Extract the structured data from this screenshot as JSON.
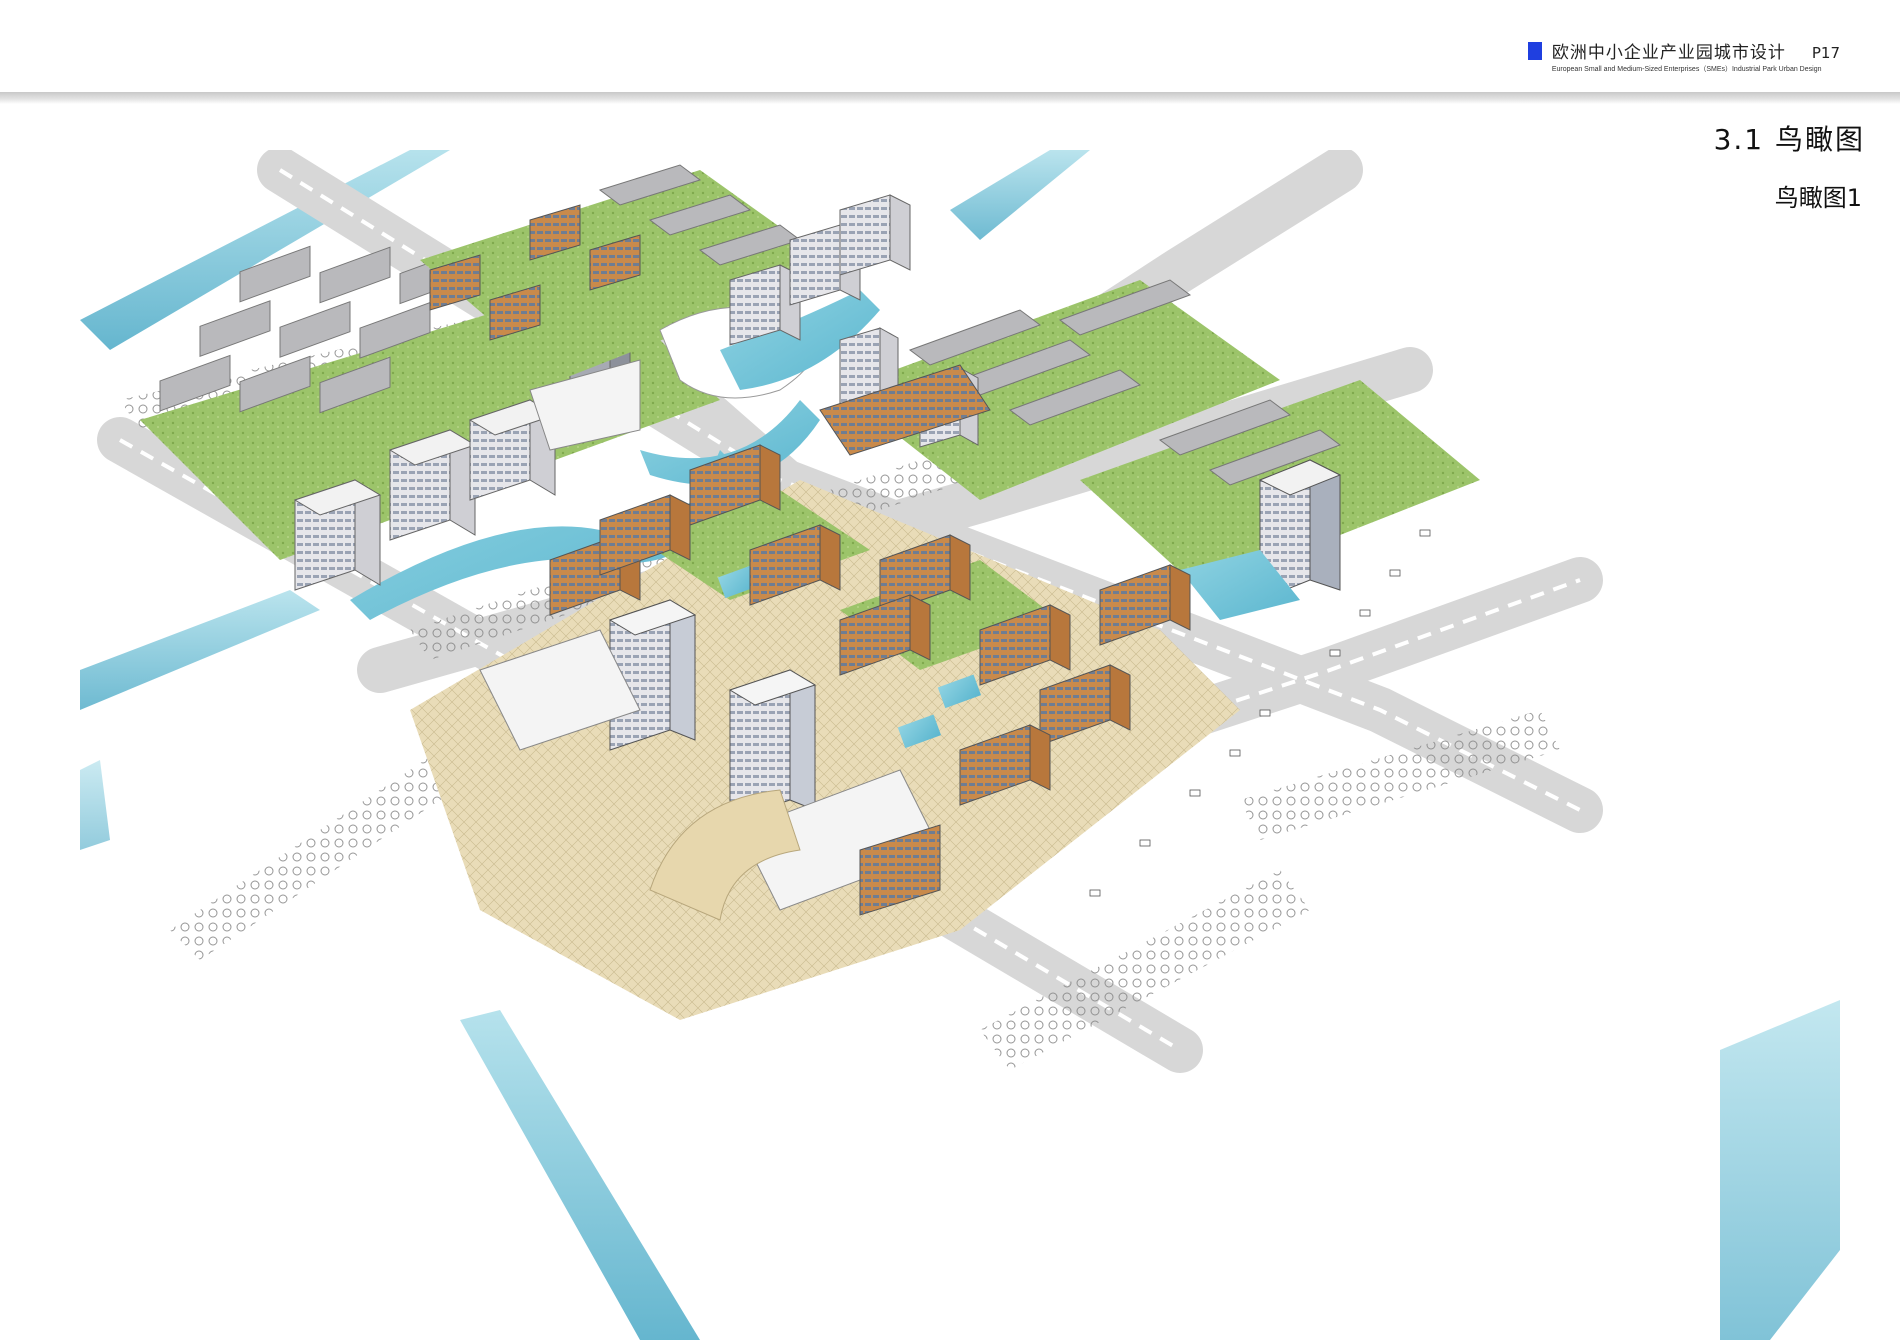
{
  "header": {
    "project_title": "欧洲中小企业产业园城市设计",
    "project_subtitle": "European Small and Medium-Sized Enterprises（SMEs）Industrial Park Urban Design",
    "page_number": "P17",
    "accent_color": "#1f3fe0"
  },
  "section": {
    "title": "3.1  鸟瞰图",
    "view_title": "鸟瞰图1"
  },
  "illustration": {
    "subject": "aerial-render"
  }
}
